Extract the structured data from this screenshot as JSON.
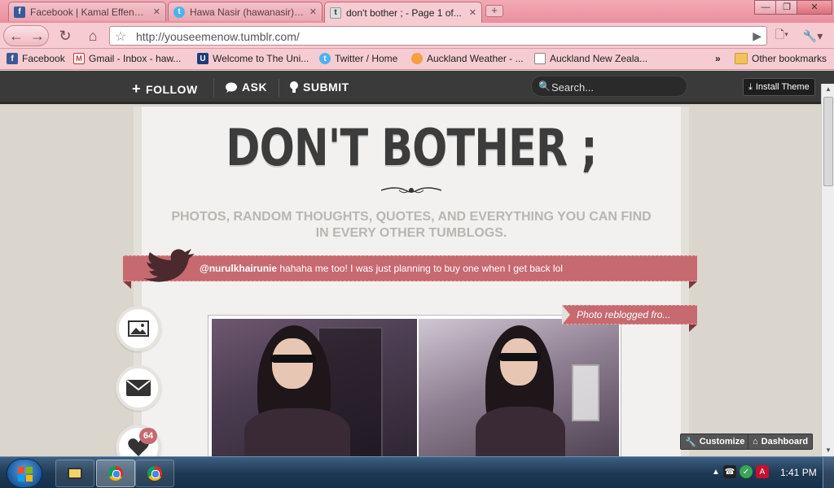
{
  "browser": {
    "tabs": [
      {
        "title": "Facebook | Kamal Effendi...",
        "favicon": "facebook-icon"
      },
      {
        "title": "Hawa Nasir (hawanasir) o...",
        "favicon": "twitter-icon"
      },
      {
        "title": "don't bother ; - Page 1 of...",
        "favicon": "tumblr-icon"
      }
    ],
    "url": "http://youseemenow.tumblr.com/",
    "bookmarks": [
      {
        "label": "Facebook",
        "icon": "facebook-icon"
      },
      {
        "label": "Gmail - Inbox - haw...",
        "icon": "gmail-icon"
      },
      {
        "label": "Welcome to The Uni...",
        "icon": "university-icon"
      },
      {
        "label": "Twitter / Home",
        "icon": "twitter-icon"
      },
      {
        "label": "Auckland Weather - ...",
        "icon": "weather-icon"
      },
      {
        "label": "Auckland New Zeala...",
        "icon": "page-icon"
      }
    ],
    "bookmarks_overflow": "»",
    "other_bookmarks": "Other bookmarks"
  },
  "tumblr_bar": {
    "follow": "FOLLOW",
    "ask": "ASK",
    "submit": "SUBMIT",
    "search_placeholder": "Search...",
    "install_theme": "Install Theme"
  },
  "blog": {
    "title": "DON'T BOTHER ;",
    "tagline": "PHOTOS, RANDOM THOUGHTS, QUOTES, AND EVERYTHING YOU CAN FIND IN EVERY OTHER TUMBLOGS.",
    "tweet_user": "@nurulkhairunie",
    "tweet_text": " hahaha me too! I was just planning to buy one when I get back lol",
    "reblog_label": "Photo reblogged fro...",
    "likes_count": "64",
    "customize": "Customize",
    "dashboard": "Dashboard"
  },
  "taskbar": {
    "clock": "1:41 PM"
  },
  "colors": {
    "chrome_theme": "#f6ccd2",
    "tumblr_bar": "#3a3a3a",
    "ribbon": "#c66a70",
    "title_text": "#3c3c3c",
    "tagline_text": "#b9b6b2"
  }
}
